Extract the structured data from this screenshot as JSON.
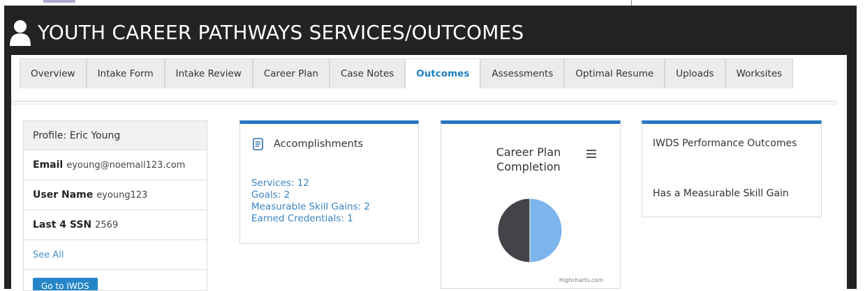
{
  "page": {
    "title": "YOUTH CAREER PATHWAYS SERVICES/OUTCOMES"
  },
  "tabs": [
    {
      "label": "Overview",
      "active": false
    },
    {
      "label": "Intake Form",
      "active": false
    },
    {
      "label": "Intake Review",
      "active": false
    },
    {
      "label": "Career Plan",
      "active": false
    },
    {
      "label": "Case Notes",
      "active": false
    },
    {
      "label": "Outcomes",
      "active": true
    },
    {
      "label": "Assessments",
      "active": false
    },
    {
      "label": "Optimal Resume",
      "active": false
    },
    {
      "label": "Uploads",
      "active": false
    },
    {
      "label": "Worksites",
      "active": false
    }
  ],
  "profile": {
    "header": "Profile: Eric Young",
    "email_label": "Email",
    "email": "eyoung@noemail123.com",
    "username_label": "User Name",
    "username": "eyoung123",
    "ssn_label": "Last 4 SSN",
    "ssn": "2569",
    "see_all": "See All",
    "button_label": "Go to IWDS"
  },
  "accomplishments": {
    "title": "Accomplishments",
    "icon": "document-icon",
    "items": [
      "Services: 12",
      "Goals: 2",
      "Measurable Skill Gains: 2",
      "Earned Credentials: 1"
    ]
  },
  "career_plan": {
    "title_line1": "Career Plan",
    "title_line2": "Completion",
    "credits": "Highcharts.com",
    "chart_data": {
      "type": "pie",
      "title": "Career Plan Completion",
      "slices": [
        {
          "value": 50,
          "color": "#7cb5ec"
        },
        {
          "value": 50,
          "color": "#434348"
        }
      ]
    }
  },
  "iwds": {
    "title": "IWDS Performance Outcomes",
    "outcome": "Has a Measurable Skill Gain"
  },
  "colors": {
    "accent": "#2575c3",
    "link": "#3b84c2",
    "active_tab": "#1e7fc1",
    "dark_bg": "#232323"
  }
}
